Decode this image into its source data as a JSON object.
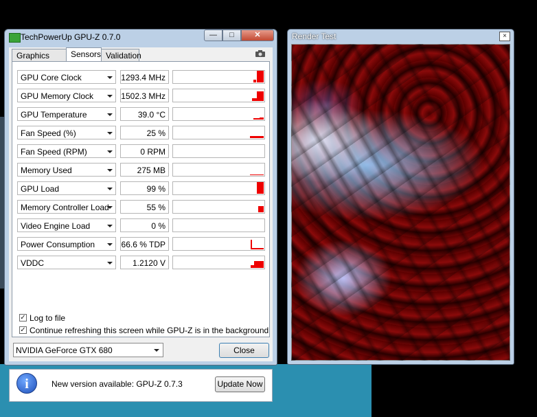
{
  "gpuz": {
    "title": "TechPowerUp GPU-Z 0.7.0",
    "controls": {
      "minimize": "—",
      "maximize": "□",
      "close": "✕"
    },
    "tabs": [
      {
        "label": "Graphics Card",
        "active": false
      },
      {
        "label": "Sensors",
        "active": true
      },
      {
        "label": "Validation",
        "active": false
      }
    ],
    "sensors": [
      {
        "name": "GPU Core Clock",
        "value": "1293.4 MHz"
      },
      {
        "name": "GPU Memory Clock",
        "value": "1502.3 MHz"
      },
      {
        "name": "GPU Temperature",
        "value": "39.0 °C"
      },
      {
        "name": "Fan Speed (%)",
        "value": "25 %"
      },
      {
        "name": "Fan Speed (RPM)",
        "value": "0 RPM"
      },
      {
        "name": "Memory Used",
        "value": "275 MB"
      },
      {
        "name": "GPU Load",
        "value": "99 %"
      },
      {
        "name": "Memory Controller Load",
        "value": "55 %"
      },
      {
        "name": "Video Engine Load",
        "value": "0 %"
      },
      {
        "name": "Power Consumption",
        "value": "66.6 % TDP"
      },
      {
        "name": "VDDC",
        "value": "1.2120 V"
      }
    ],
    "options": {
      "log_to_file": "Log to file",
      "continue_refresh": "Continue refreshing this screen while GPU-Z is in the background"
    },
    "gpu_select": "NVIDIA GeForce GTX 680",
    "close_label": "Close",
    "accent_color": "#ee0000"
  },
  "notification": {
    "text": "New version available: GPU-Z 0.7.3",
    "button": "Update Now",
    "icon": "i"
  },
  "render_test": {
    "title": "Render Test",
    "close": "×"
  }
}
